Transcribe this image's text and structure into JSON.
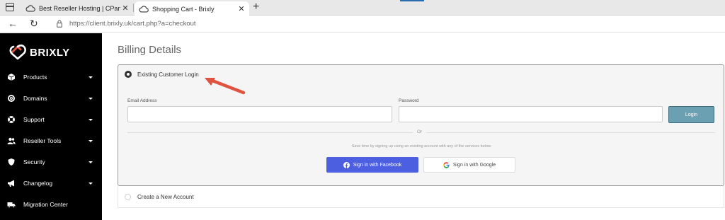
{
  "browser": {
    "tabs": [
      {
        "title": "Best Reseller Hosting | CPanel Re",
        "active": false
      },
      {
        "title": "Shopping Cart - Brixly",
        "active": true
      }
    ],
    "url": "https://client.brixly.uk/cart.php?a=checkout"
  },
  "sidebar": {
    "logo": "BRIXLY",
    "items": [
      {
        "label": "Products",
        "icon": "cube-icon",
        "has_caret": true
      },
      {
        "label": "Domains",
        "icon": "globe-icon",
        "has_caret": true
      },
      {
        "label": "Support",
        "icon": "lifebuoy-icon",
        "has_caret": true
      },
      {
        "label": "Reseller Tools",
        "icon": "users-icon",
        "has_caret": true
      },
      {
        "label": "Security",
        "icon": "shield-icon",
        "has_caret": true
      },
      {
        "label": "Changelog",
        "icon": "megaphone-icon",
        "has_caret": true
      },
      {
        "label": "Migration Center",
        "icon": "truck-icon",
        "has_caret": false
      }
    ]
  },
  "main": {
    "title": "Billing Details",
    "existing_login": {
      "label": "Existing Customer Login",
      "email_label": "Email Address",
      "email_value": "",
      "password_label": "Password",
      "password_value": "",
      "login_button": "Login",
      "or_text": "Or",
      "hint": "Save time by signing up using an existing account with any of the services below.",
      "facebook_button": "Sign in with Facebook",
      "google_button": "Sign in with Google"
    },
    "new_account": {
      "label": "Create a New Account"
    }
  },
  "colors": {
    "sidebar_bg": "#000000",
    "login_button": "#6aa0b2",
    "facebook_button": "#4b5fe0",
    "annotation_arrow": "#e0533f"
  }
}
